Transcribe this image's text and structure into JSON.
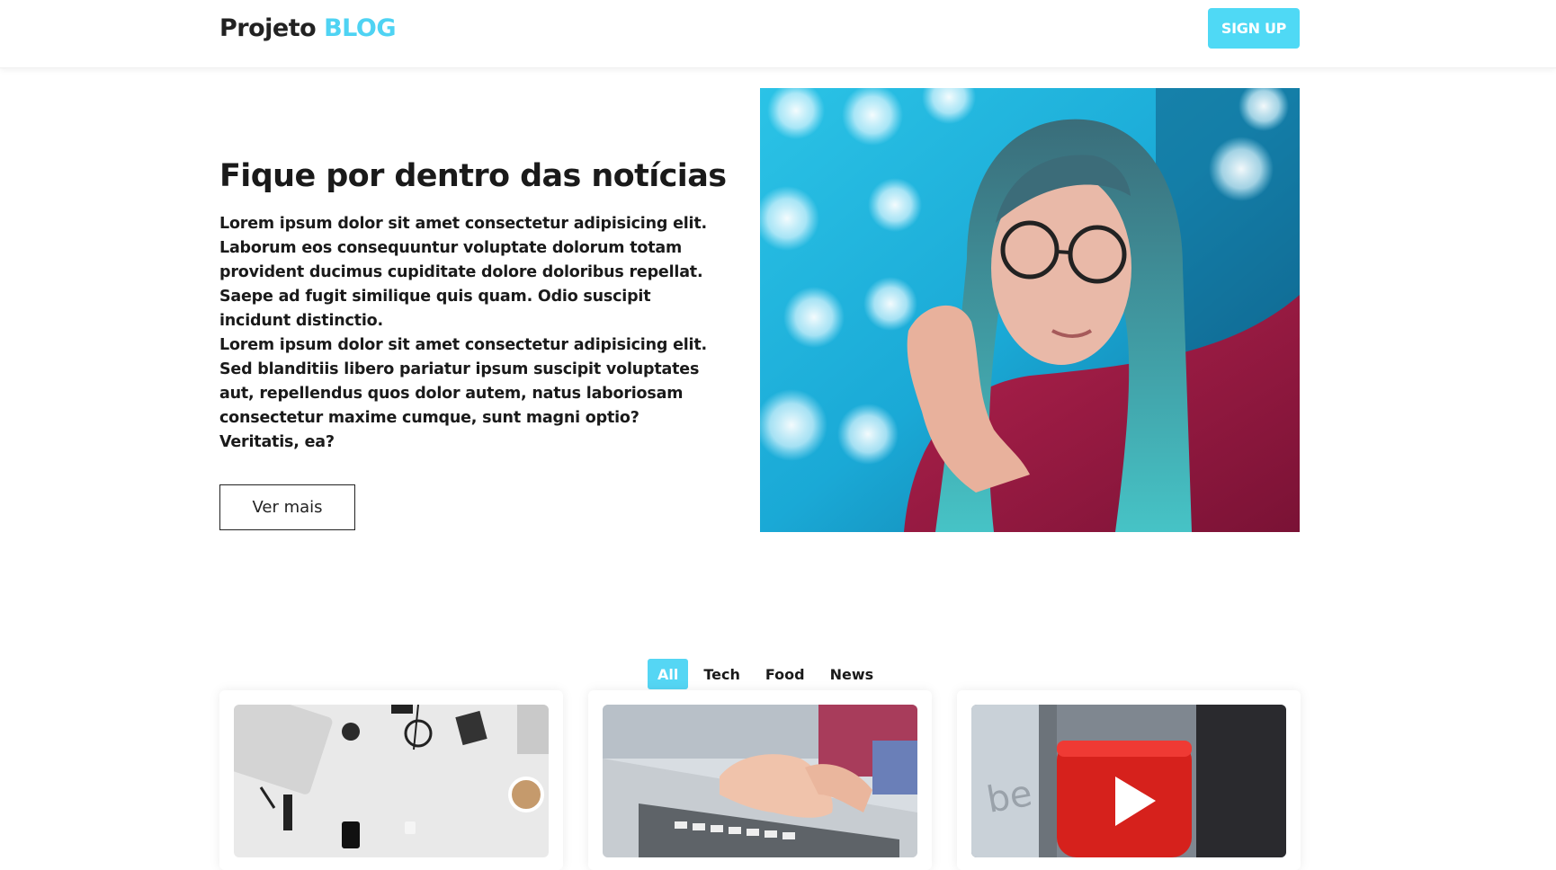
{
  "header": {
    "logo_main": "Projeto",
    "logo_accent": "BLOG",
    "signup_label": "SIGN UP"
  },
  "hero": {
    "title": "Fique por dentro das notícias",
    "paragraph_1": "Lorem ipsum dolor sit amet consectetur adipisicing elit. Laborum eos consequuntur voluptate dolorum totam provident ducimus cupiditate dolore doloribus repellat. Saepe ad fugit similique quis quam. Odio suscipit incidunt distinctio.",
    "paragraph_2": "Lorem ipsum dolor sit amet consectetur adipisicing elit. Sed blanditiis libero pariatur ipsum suscipit voluptates aut, repellendus quos dolor autem, natus laboriosam consectetur maxime cumque, sunt magni optio? Veritatis, ea?",
    "button_label": "Ver mais"
  },
  "filters": [
    {
      "label": "All",
      "active": true
    },
    {
      "label": "Tech",
      "active": false
    },
    {
      "label": "Food",
      "active": false
    },
    {
      "label": "News",
      "active": false
    }
  ],
  "colors": {
    "accent": "#4fd9f5",
    "text": "#1a1a1a"
  }
}
